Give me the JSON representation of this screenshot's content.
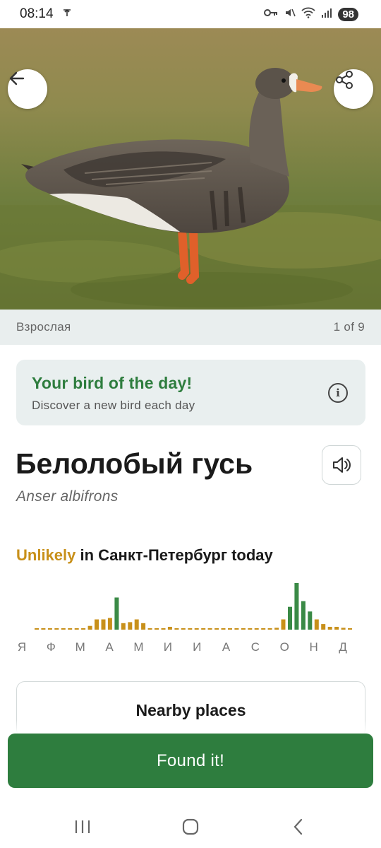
{
  "status_bar": {
    "time": "08:14",
    "battery": "98",
    "icons": [
      "notification-icon",
      "key-icon",
      "mute-icon",
      "wifi-icon",
      "signal-icon"
    ]
  },
  "hero": {
    "subject": "goose-photo",
    "caption": "Взрослая",
    "counter": "1 of 9"
  },
  "bird_of_day": {
    "title": "Your bird of the day!",
    "subtitle": "Discover a new bird each day"
  },
  "bird": {
    "name": "Белолобый гусь",
    "latin": "Anser albifrons"
  },
  "likelihood": {
    "word": "Unlikely",
    "rest": " in Санкт-Петербург today"
  },
  "chart_data": {
    "type": "bar",
    "categories": [
      "Я",
      "Ф",
      "М",
      "А",
      "М",
      "И",
      "И",
      "А",
      "С",
      "О",
      "Н",
      "Д"
    ],
    "values": [
      0.02,
      0.02,
      0.02,
      0,
      0.02,
      0,
      0.02,
      0.02,
      0.08,
      0.22,
      0.22,
      0.25,
      0.69,
      0.14,
      0.16,
      0.22,
      0.14,
      0.02,
      0.02,
      0,
      0.06,
      0,
      0,
      0,
      0,
      0,
      0,
      0.02,
      0.02,
      0.02,
      0,
      0.02,
      0.02,
      0.02,
      0.02,
      0.02,
      0.04,
      0.22,
      0.49,
      1.0,
      0.61,
      0.39,
      0.22,
      0.12,
      0.06,
      0.06,
      0.04,
      0.02
    ],
    "value_unit": "relative frequency (weekly, max = 1)",
    "colors": {
      "low": "#c8901a",
      "high": "#3a8a46"
    },
    "high_threshold": 0.3
  },
  "buttons": {
    "nearby": "Nearby places",
    "found": "Found it!"
  },
  "colors": {
    "primary_green": "#2e7d3e",
    "accent_gold": "#c8901a",
    "card_bg": "#e9efef"
  }
}
